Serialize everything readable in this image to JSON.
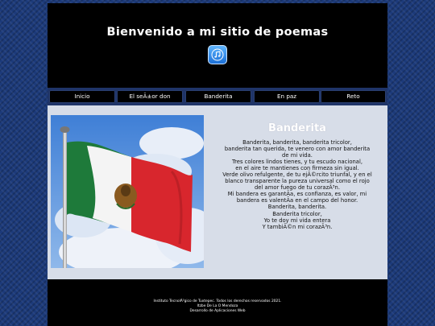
{
  "header": {
    "title": "Bienvenido a mi sitio de poemas",
    "icon": "music-note-icon"
  },
  "nav": {
    "items": [
      {
        "label": "Inicio"
      },
      {
        "label": "El seÃ±or don tecolote"
      },
      {
        "label": "Banderita"
      },
      {
        "label": "En paz"
      },
      {
        "label": "Reto"
      }
    ]
  },
  "main": {
    "image": "mexican-flag-photo",
    "poem_title": "Banderita",
    "poem_lines": [
      "Banderita, banderita, banderita tricolor,",
      "banderita tan querida, te venero con amor banderita",
      "de mi vida.",
      "Tres colores lindos tienes, y tu escudo nacional,",
      "en el aire te mantienes con firmeza sin igual.",
      "Verde olivo refulgente, de tu ejÃ©rcito triunfal, y en el",
      "blanco transparente la pureza universal como el rojo",
      "del amor fuego de tu corazÃ³n.",
      "Mi bandera es garantÃa, es confianza, es valor, mi",
      "bandera es valentÃa en el campo del honor.",
      "Banderita, banderita.",
      "Banderita tricolor,",
      "Yo te doy mi vida entera",
      "Y tambiÃ©n mi corazÃ³n."
    ]
  },
  "footer": {
    "line1": "Instituto TecnolÃ³gico de Tuxtepec. Todos los derechos reservados 2021.",
    "line2": "Itzbe De La O Mendoza",
    "line3": "Desarrollo de Aplicaciones Web"
  },
  "colors": {
    "page_background": "#1c3a7a",
    "header_background": "#000000",
    "nav_background": "#1f3468",
    "main_background": "#d7dde8",
    "flag_green": "#1e7a3a",
    "flag_white": "#f4f4f4",
    "flag_red": "#d8262d"
  }
}
